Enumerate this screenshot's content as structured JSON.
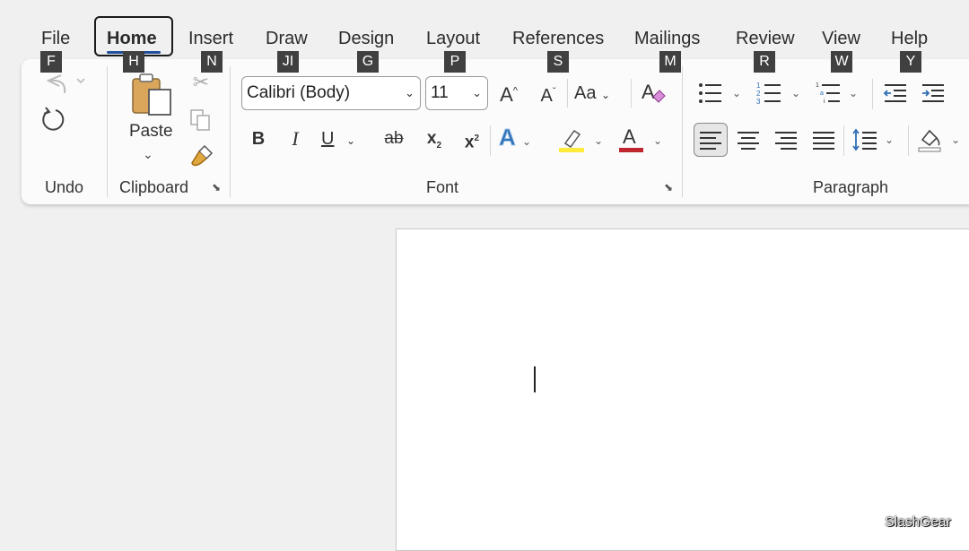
{
  "tabs": [
    {
      "label": "File",
      "keytip": "F"
    },
    {
      "label": "Home",
      "keytip": "H"
    },
    {
      "label": "Insert",
      "keytip": "N"
    },
    {
      "label": "Draw",
      "keytip": "JI"
    },
    {
      "label": "Design",
      "keytip": "G"
    },
    {
      "label": "Layout",
      "keytip": "P"
    },
    {
      "label": "References",
      "keytip": "S"
    },
    {
      "label": "Mailings",
      "keytip": "M"
    },
    {
      "label": "Review",
      "keytip": "R"
    },
    {
      "label": "View",
      "keytip": "W"
    },
    {
      "label": "Help",
      "keytip": "Y"
    }
  ],
  "active_tab": "Home",
  "groups": {
    "undo": {
      "label": "Undo"
    },
    "clipboard": {
      "label": "Clipboard",
      "paste_label": "Paste"
    },
    "font": {
      "label": "Font",
      "font_name": "Calibri (Body)",
      "font_size": "11",
      "change_case": "Aa",
      "grow": "A",
      "shrink": "A",
      "bold": "B",
      "italic": "I",
      "underline": "U",
      "strike": "ab",
      "subscript": "x",
      "superscript": "x",
      "text_effects": "A",
      "font_color": "A"
    },
    "paragraph": {
      "label": "Paragraph"
    }
  },
  "icons": [
    "undo-icon",
    "redo-icon",
    "paste-icon",
    "cut-icon",
    "copy-icon",
    "format-painter-icon",
    "clear-formatting-icon",
    "bullets-icon",
    "numbering-icon",
    "multilevel-list-icon",
    "decrease-indent-icon",
    "increase-indent-icon",
    "align-left-icon",
    "center-icon",
    "align-right-icon",
    "justify-icon",
    "line-spacing-icon",
    "shading-icon"
  ],
  "colors": {
    "highlight": "#ffeb3b",
    "font_color": "#c0262d",
    "text_effects": "#2f6fb5",
    "accent": "#1f4e9c"
  },
  "watermark": "SlashGear"
}
